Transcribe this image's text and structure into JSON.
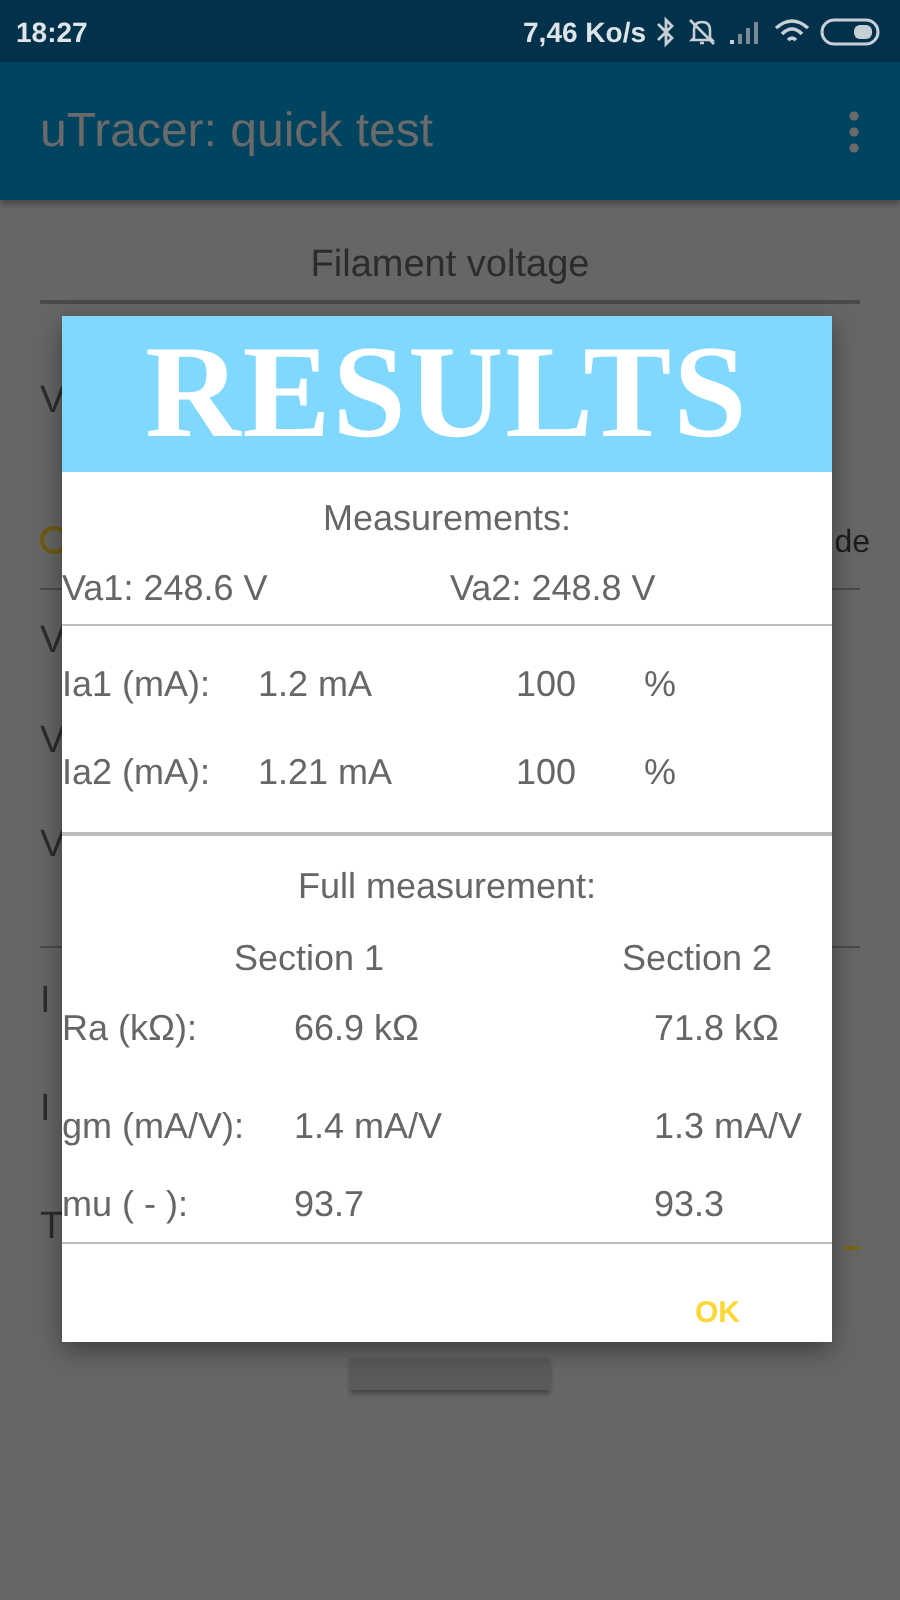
{
  "status_bar": {
    "time": "18:27",
    "net_speed": "7,46 Ko/s"
  },
  "app_bar": {
    "title": "uTracer: quick test"
  },
  "background": {
    "heading": "Filament voltage",
    "rows": [
      {
        "kind": "label",
        "text": "V"
      },
      {
        "kind": "radio",
        "text": "de",
        "checked": false
      },
      {
        "kind": "label",
        "text": "V"
      },
      {
        "kind": "label",
        "text": "V"
      },
      {
        "kind": "label",
        "text": "V"
      },
      {
        "kind": "label",
        "text": "I"
      },
      {
        "kind": "label",
        "text": "I"
      },
      {
        "kind": "field",
        "text": "T"
      },
      {
        "kind": "button"
      }
    ]
  },
  "dialog": {
    "title": "RESULTS",
    "measurements_heading": "Measurements:",
    "voltages": [
      "Va1: 248.6 V",
      "Va2: 248.8 V"
    ],
    "currents": [
      {
        "label": "Ia1 (mA):",
        "value": "1.2 mA",
        "percent": "100",
        "unit": "%"
      },
      {
        "label": "Ia2 (mA):",
        "value": "1.21 mA",
        "percent": "100",
        "unit": "%"
      }
    ],
    "full_heading": "Full measurement:",
    "sections": [
      "Section 1",
      "Section 2"
    ],
    "results": [
      {
        "label": "Ra (kΩ):",
        "values": [
          "66.9 kΩ",
          "71.8 kΩ"
        ]
      },
      {
        "label": "gm (mA/V):",
        "values": [
          "1.4 mA/V",
          "1.3 mA/V"
        ]
      },
      {
        "label": "mu ( - ):",
        "values": [
          "93.7",
          "93.3"
        ]
      }
    ],
    "ok": "OK"
  }
}
